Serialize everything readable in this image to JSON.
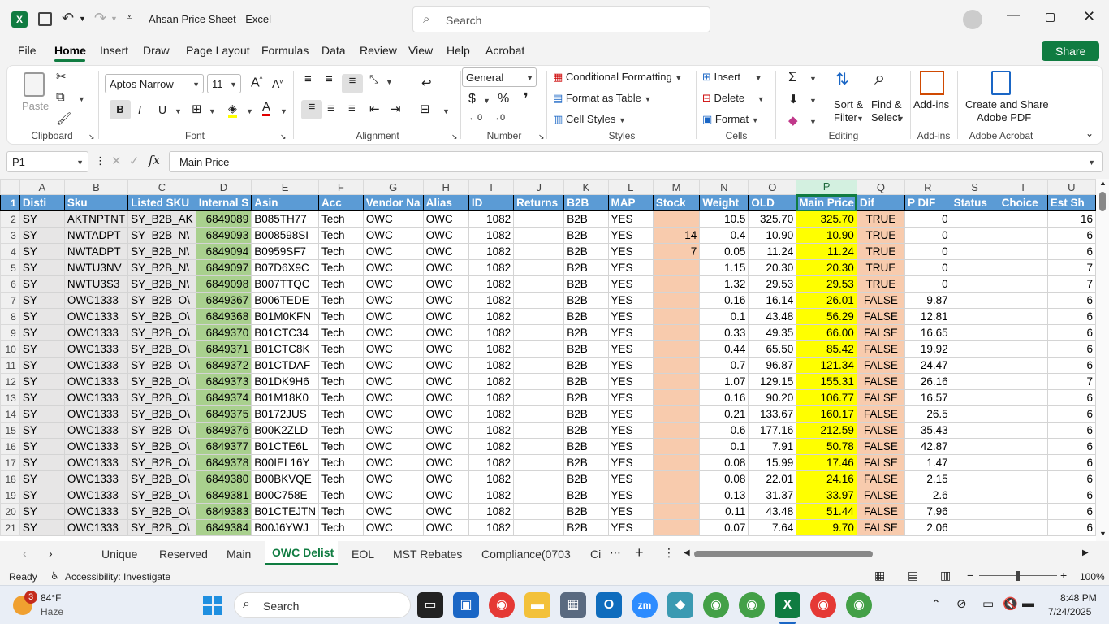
{
  "window": {
    "title": "Ahsan Price Sheet  -  Excel",
    "search_placeholder": "Search"
  },
  "menu": {
    "tabs": [
      "File",
      "Home",
      "Insert",
      "Draw",
      "Page Layout",
      "Formulas",
      "Data",
      "Review",
      "View",
      "Help",
      "Acrobat"
    ],
    "share": "Share"
  },
  "ribbon": {
    "clipboard": {
      "paste": "Paste",
      "label": "Clipboard"
    },
    "font": {
      "name": "Aptos Narrow",
      "size": "11",
      "label": "Font"
    },
    "alignment": {
      "label": "Alignment"
    },
    "number": {
      "format": "General",
      "label": "Number"
    },
    "styles": {
      "cond": "Conditional Formatting",
      "table": "Format as Table",
      "cell": "Cell Styles",
      "label": "Styles"
    },
    "cells": {
      "insert": "Insert",
      "delete": "Delete",
      "format": "Format",
      "label": "Cells"
    },
    "editing": {
      "sort1": "Sort &",
      "sort2": "Filter",
      "find1": "Find &",
      "find2": "Select",
      "label": "Editing"
    },
    "addins": {
      "btn": "Add-ins",
      "label": "Add-ins"
    },
    "acrobat": {
      "btn1": "Create and Share",
      "btn2": "Adobe PDF",
      "label": "Adobe Acrobat"
    }
  },
  "formula_bar": {
    "name_box": "P1",
    "content": "Main Price"
  },
  "grid": {
    "columns": [
      "A",
      "B",
      "C",
      "D",
      "E",
      "F",
      "G",
      "H",
      "I",
      "J",
      "K",
      "L",
      "M",
      "N",
      "O",
      "P",
      "Q",
      "R",
      "S",
      "T",
      "U"
    ],
    "headers": [
      "Disti",
      "Sku",
      "Listed SKU",
      "Internal S",
      "Asin",
      "Acc",
      "Vendor Na",
      "Alias",
      "ID",
      "Returns",
      "B2B",
      "MAP",
      "Stock",
      "Weight",
      "OLD",
      "Main Price",
      "Dif",
      "P DIF",
      "Status",
      "Choice",
      "Est Sh"
    ],
    "rows": [
      {
        "n": "2",
        "b": "AKTNPTNT",
        "c": "SY_B2B_AK",
        "d": "6849089",
        "e": "B085TH77",
        "m": "",
        "w": "10.5",
        "old": "325.70",
        "main": "325.70",
        "dif": "TRUE",
        "pdif": "0",
        "u": "16"
      },
      {
        "n": "3",
        "b": "NWTADPT",
        "c": "SY_B2B_N\\",
        "d": "6849093",
        "e": "B008598SI",
        "m": "14",
        "w": "0.4",
        "old": "10.90",
        "main": "10.90",
        "dif": "TRUE",
        "pdif": "0",
        "u": "6"
      },
      {
        "n": "4",
        "b": "NWTADPT",
        "c": "SY_B2B_N\\",
        "d": "6849094",
        "e": "B0959SF7",
        "m": "7",
        "w": "0.05",
        "old": "11.24",
        "main": "11.24",
        "dif": "TRUE",
        "pdif": "0",
        "u": "6"
      },
      {
        "n": "5",
        "b": "NWTU3NV",
        "c": "SY_B2B_N\\",
        "d": "6849097",
        "e": "B07D6X9C",
        "m": "",
        "w": "1.15",
        "old": "20.30",
        "main": "20.30",
        "dif": "TRUE",
        "pdif": "0",
        "u": "7"
      },
      {
        "n": "6",
        "b": "NWTU3S3",
        "c": "SY_B2B_N\\",
        "d": "6849098",
        "e": "B007TTQC",
        "m": "",
        "w": "1.32",
        "old": "29.53",
        "main": "29.53",
        "dif": "TRUE",
        "pdif": "0",
        "u": "7"
      },
      {
        "n": "7",
        "b": "OWC1333",
        "c": "SY_B2B_O\\",
        "d": "6849367",
        "e": "B006TEDE",
        "m": "",
        "w": "0.16",
        "old": "16.14",
        "main": "26.01",
        "dif": "FALSE",
        "pdif": "9.87",
        "u": "6"
      },
      {
        "n": "8",
        "b": "OWC1333",
        "c": "SY_B2B_O\\",
        "d": "6849368",
        "e": "B01M0KFN",
        "m": "",
        "w": "0.1",
        "old": "43.48",
        "main": "56.29",
        "dif": "FALSE",
        "pdif": "12.81",
        "u": "6"
      },
      {
        "n": "9",
        "b": "OWC1333",
        "c": "SY_B2B_O\\",
        "d": "6849370",
        "e": "B01CTC34",
        "m": "",
        "w": "0.33",
        "old": "49.35",
        "main": "66.00",
        "dif": "FALSE",
        "pdif": "16.65",
        "u": "6"
      },
      {
        "n": "10",
        "b": "OWC1333",
        "c": "SY_B2B_O\\",
        "d": "6849371",
        "e": "B01CTC8K",
        "m": "",
        "w": "0.44",
        "old": "65.50",
        "main": "85.42",
        "dif": "FALSE",
        "pdif": "19.92",
        "u": "6"
      },
      {
        "n": "11",
        "b": "OWC1333",
        "c": "SY_B2B_O\\",
        "d": "6849372",
        "e": "B01CTDAF",
        "m": "",
        "w": "0.7",
        "old": "96.87",
        "main": "121.34",
        "dif": "FALSE",
        "pdif": "24.47",
        "u": "6"
      },
      {
        "n": "12",
        "b": "OWC1333",
        "c": "SY_B2B_O\\",
        "d": "6849373",
        "e": "B01DK9H6",
        "m": "",
        "w": "1.07",
        "old": "129.15",
        "main": "155.31",
        "dif": "FALSE",
        "pdif": "26.16",
        "u": "7"
      },
      {
        "n": "13",
        "b": "OWC1333",
        "c": "SY_B2B_O\\",
        "d": "6849374",
        "e": "B01M18K0",
        "m": "",
        "w": "0.16",
        "old": "90.20",
        "main": "106.77",
        "dif": "FALSE",
        "pdif": "16.57",
        "u": "6"
      },
      {
        "n": "14",
        "b": "OWC1333",
        "c": "SY_B2B_O\\",
        "d": "6849375",
        "e": "B0172JUS",
        "m": "",
        "w": "0.21",
        "old": "133.67",
        "main": "160.17",
        "dif": "FALSE",
        "pdif": "26.5",
        "u": "6"
      },
      {
        "n": "15",
        "b": "OWC1333",
        "c": "SY_B2B_O\\",
        "d": "6849376",
        "e": "B00K2ZLD",
        "m": "",
        "w": "0.6",
        "old": "177.16",
        "main": "212.59",
        "dif": "FALSE",
        "pdif": "35.43",
        "u": "6"
      },
      {
        "n": "16",
        "b": "OWC1333",
        "c": "SY_B2B_O\\",
        "d": "6849377",
        "e": "B01CTE6L",
        "m": "",
        "w": "0.1",
        "old": "7.91",
        "main": "50.78",
        "dif": "FALSE",
        "pdif": "42.87",
        "u": "6"
      },
      {
        "n": "17",
        "b": "OWC1333",
        "c": "SY_B2B_O\\",
        "d": "6849378",
        "e": "B00IEL16Y",
        "m": "",
        "w": "0.08",
        "old": "15.99",
        "main": "17.46",
        "dif": "FALSE",
        "pdif": "1.47",
        "u": "6"
      },
      {
        "n": "18",
        "b": "OWC1333",
        "c": "SY_B2B_O\\",
        "d": "6849380",
        "e": "B00BKVQE",
        "m": "",
        "w": "0.08",
        "old": "22.01",
        "main": "24.16",
        "dif": "FALSE",
        "pdif": "2.15",
        "u": "6"
      },
      {
        "n": "19",
        "b": "OWC1333",
        "c": "SY_B2B_O\\",
        "d": "6849381",
        "e": "B00C758E",
        "m": "",
        "w": "0.13",
        "old": "31.37",
        "main": "33.97",
        "dif": "FALSE",
        "pdif": "2.6",
        "u": "6"
      },
      {
        "n": "20",
        "b": "OWC1333",
        "c": "SY_B2B_O\\",
        "d": "6849383",
        "e": "B01CTEJTN",
        "m": "",
        "w": "0.11",
        "old": "43.48",
        "main": "51.44",
        "dif": "FALSE",
        "pdif": "7.96",
        "u": "6"
      },
      {
        "n": "21",
        "b": "OWC1333",
        "c": "SY_B2B_O\\",
        "d": "6849384",
        "e": "B00J6YWJ",
        "m": "",
        "w": "0.07",
        "old": "7.64",
        "main": "9.70",
        "dif": "FALSE",
        "pdif": "2.06",
        "u": "6"
      }
    ],
    "fixed": {
      "a": "SY",
      "f": "Tech",
      "g": "OWC",
      "h": "OWC",
      "i": "1082",
      "k": "B2B",
      "l": "YES"
    }
  },
  "sheets": {
    "tabs": [
      "Unique",
      "Reserved",
      "Main",
      "OWC Delist",
      "EOL",
      "MST Rebates",
      "Compliance(0703",
      "Ci"
    ],
    "active": "OWC Delist"
  },
  "status": {
    "ready": "Ready",
    "accessibility": "Accessibility: Investigate",
    "zoom": "100%"
  },
  "taskbar": {
    "temp": "84°F",
    "weather": "Haze",
    "badge": "3",
    "search": "Search",
    "time": "8:48 PM",
    "date": "7/24/2025"
  },
  "colors": {
    "excel_green": "#107c41",
    "header_blue": "#5b9bd5"
  }
}
